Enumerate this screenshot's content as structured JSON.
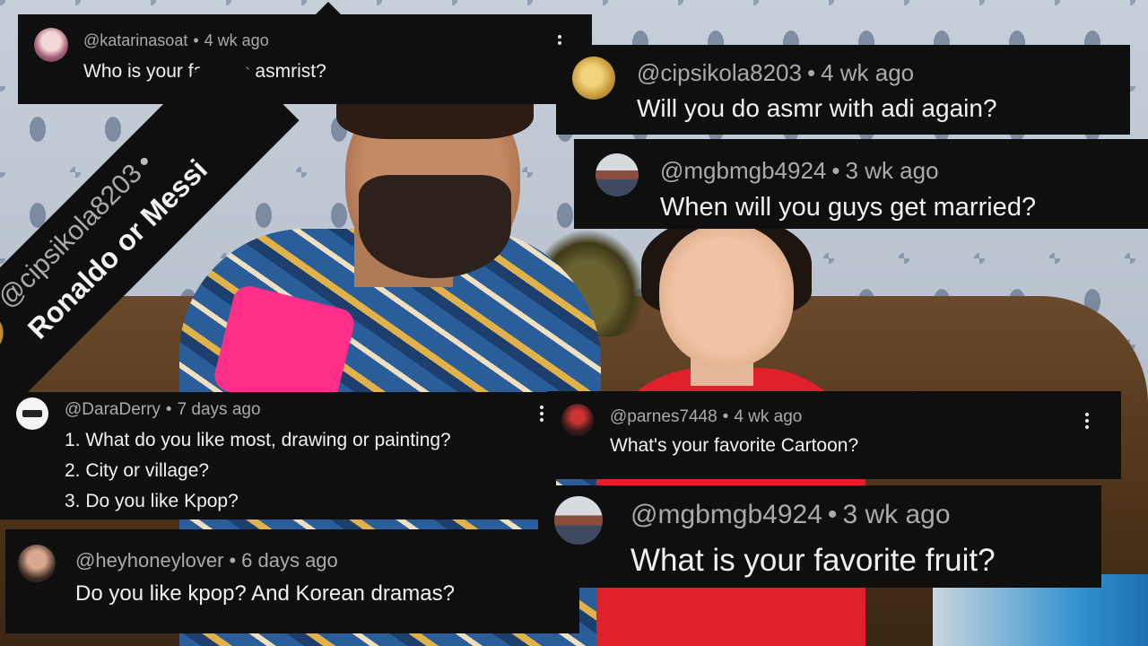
{
  "comments": {
    "katarinasoat": {
      "username": "@katarinasoat",
      "time": "4 wk ago",
      "text": "Who is your favorite asmrist?",
      "separator": "•"
    },
    "cipsikola_main": {
      "username": "@cipsikola8203",
      "time": "4 wk ago",
      "text": "Will you do asmr with adi again?",
      "separator": "•"
    },
    "mgbmgb_married": {
      "username": "@mgbmgb4924",
      "time": "3 wk ago",
      "text": "When will you guys get married?",
      "separator": "•"
    },
    "cipsikola_rotated": {
      "username": "@cipsikola8203",
      "time": "",
      "text": "Ronaldo or Messi",
      "separator": "•"
    },
    "daraderry": {
      "username": "@DaraDerry",
      "time": "7 days ago",
      "separator": "•",
      "lines": [
        "1. What do you like most, drawing or painting?",
        "2. City or village?",
        "3. Do you like Kpop?"
      ]
    },
    "parnes": {
      "username": "@parnes7448",
      "time": "4 wk ago",
      "text": "What's your favorite Cartoon?",
      "separator": "•"
    },
    "heyhoneylover": {
      "username": "@heyhoneylover",
      "time": "6 days ago",
      "text": "Do you like kpop? And Korean dramas?",
      "separator": "•"
    },
    "mgbmgb_fruit": {
      "username": "@mgbmgb4924",
      "time": "3 wk ago",
      "text": "What is your favorite fruit?",
      "separator": "•"
    }
  },
  "icons": {
    "menu": "vertical-ellipsis-icon"
  },
  "colors": {
    "card_bg": "#0f0f0f",
    "meta_text": "#aaaaaa",
    "body_text": "#f1f1f1"
  }
}
